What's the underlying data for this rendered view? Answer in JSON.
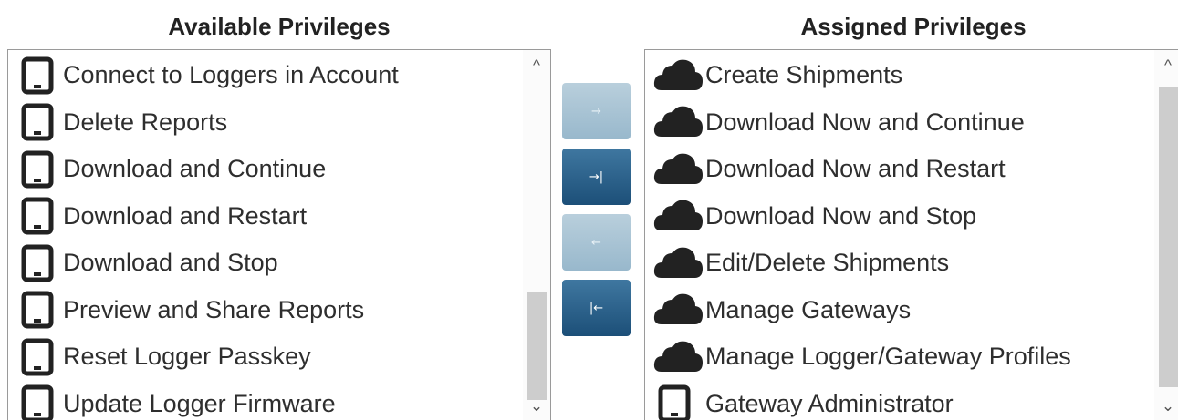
{
  "available": {
    "title": "Available Privileges",
    "items": [
      {
        "label": "Connect to Loggers in Account",
        "icon": "tablet-icon"
      },
      {
        "label": "Delete Reports",
        "icon": "tablet-icon"
      },
      {
        "label": "Download and Continue",
        "icon": "tablet-icon"
      },
      {
        "label": "Download and Restart",
        "icon": "tablet-icon"
      },
      {
        "label": "Download and Stop",
        "icon": "tablet-icon"
      },
      {
        "label": "Preview and Share Reports",
        "icon": "tablet-icon"
      },
      {
        "label": "Reset Logger Passkey",
        "icon": "tablet-icon"
      },
      {
        "label": "Update Logger Firmware",
        "icon": "tablet-icon"
      }
    ]
  },
  "assigned": {
    "title": "Assigned Privileges",
    "items": [
      {
        "label": "Create Shipments",
        "icon": "cloud-icon"
      },
      {
        "label": "Download Now and Continue",
        "icon": "cloud-icon"
      },
      {
        "label": "Download Now and Restart",
        "icon": "cloud-icon"
      },
      {
        "label": "Download Now and Stop",
        "icon": "cloud-icon"
      },
      {
        "label": "Edit/Delete Shipments",
        "icon": "cloud-icon"
      },
      {
        "label": "Manage Gateways",
        "icon": "cloud-icon"
      },
      {
        "label": "Manage Logger/Gateway Profiles",
        "icon": "cloud-icon"
      },
      {
        "label": "Gateway Administrator",
        "icon": "tablet-icon"
      }
    ]
  },
  "buttons": {
    "add": {
      "glyph": "→",
      "state": "disabled"
    },
    "add_all": {
      "glyph": "→|",
      "state": "enabled"
    },
    "remove": {
      "glyph": "←",
      "state": "disabled"
    },
    "remove_all": {
      "glyph": "|←",
      "state": "enabled"
    }
  },
  "scroll": {
    "up_glyph": "^",
    "down_glyph": "⌄"
  },
  "colors": {
    "button_enabled": "#1c4f78",
    "button_disabled": "#a9c4d4",
    "icon": "#222222"
  }
}
